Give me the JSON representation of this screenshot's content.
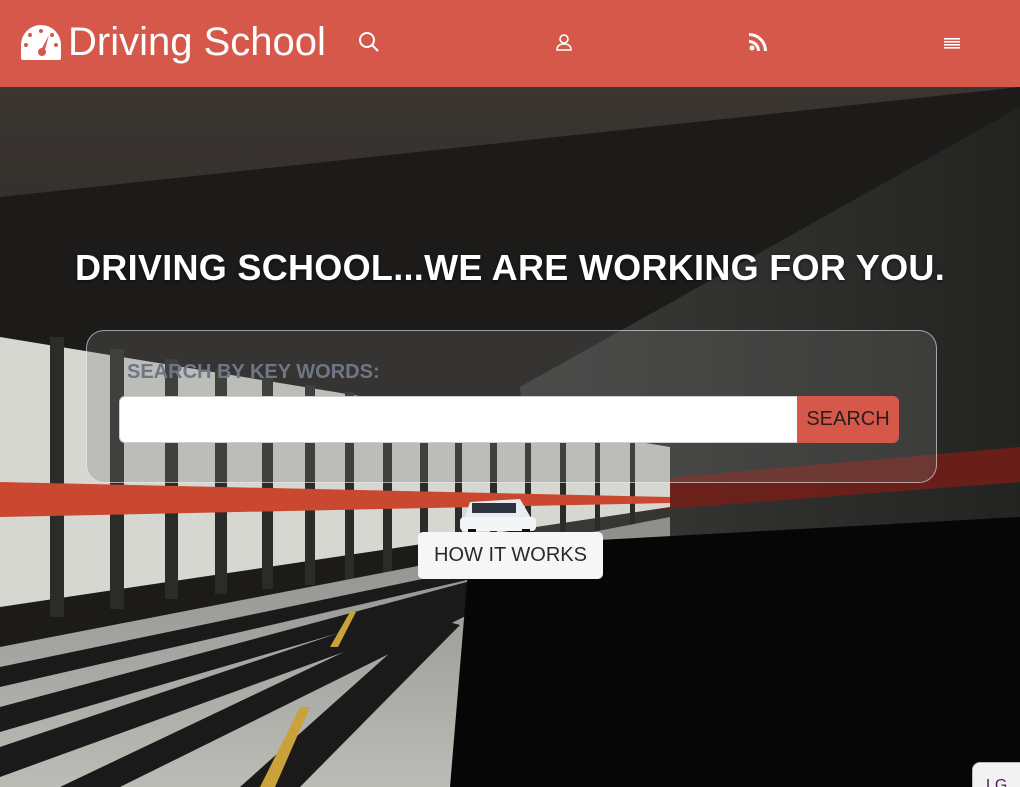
{
  "header": {
    "brand_name": "Driving School",
    "bg_color": "#d5584a",
    "icons": [
      "speedometer-icon",
      "search-icon",
      "user-icon",
      "rss-icon",
      "menu-icon"
    ]
  },
  "hero": {
    "headline": "DRIVING SCHOOL...WE ARE WORKING FOR YOU.",
    "search": {
      "label": "SEARCH BY KEY WORDS:",
      "value": "",
      "button_label": "SEARCH"
    },
    "how_button_label": "HOW IT WORKS"
  },
  "corner_badge": "LG"
}
